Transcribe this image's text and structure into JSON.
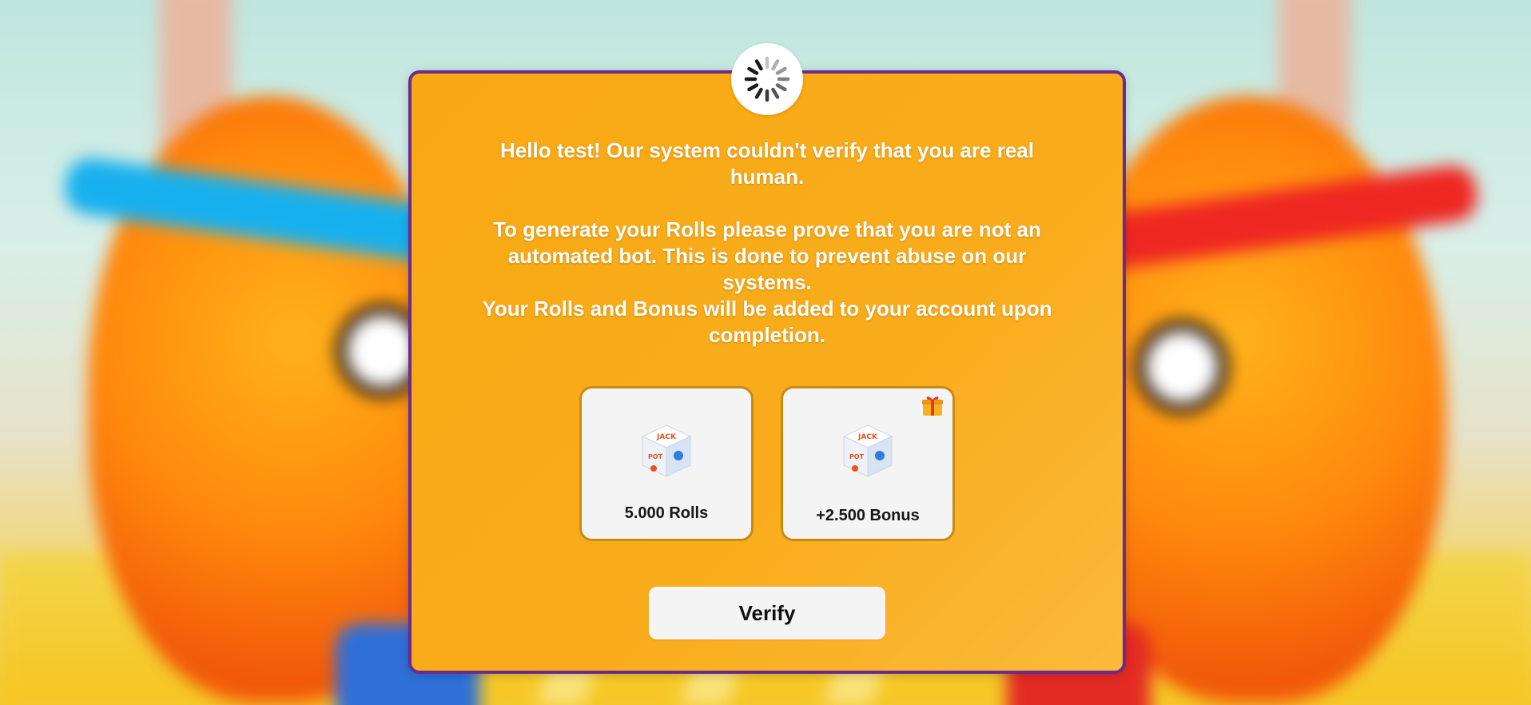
{
  "modal": {
    "message_lines_1": [
      "Hello test! Our system couldn't verify that you are real",
      "human."
    ],
    "message_line_1a": "Hello test! Our system couldn't verify that you are real",
    "message_line_1b": "human.",
    "message_line_2a": "To generate your Rolls please prove that you are not an",
    "message_line_2b": "automated bot. This is done to prevent abuse on our",
    "message_line_2c": "systems.",
    "message_line_3a": "Your Rolls and Bonus will be added to your account upon",
    "message_line_3b": "completion."
  },
  "rewards": {
    "rolls_label": "5.000 Rolls",
    "bonus_label": "+2.500 Bonus"
  },
  "verify_label": "Verify",
  "colors": {
    "modal_bg": "#f9ad1c",
    "modal_border": "#6a2a92",
    "card_bg": "#f4f4f4",
    "button_bg": "#f4f4f4"
  },
  "icons": {
    "loading": "spinner-icon",
    "dice": "dice-icon",
    "gift": "gift-icon"
  }
}
